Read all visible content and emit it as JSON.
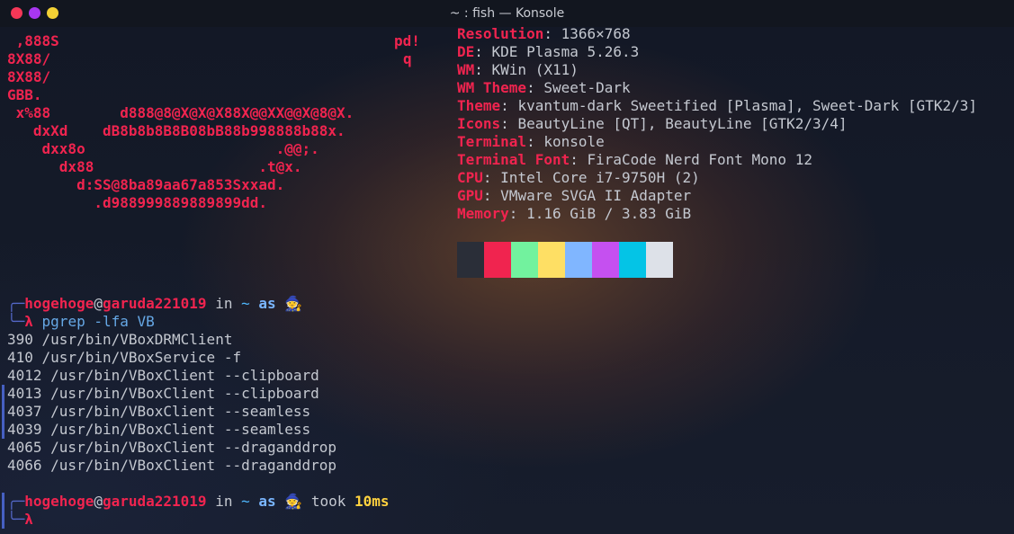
{
  "window": {
    "title": "~ : fish — Konsole",
    "buttons": [
      "close",
      "maximize",
      "minimize"
    ]
  },
  "ascii_art": [
    {
      "text": " ,888S",
      "right": "pd!",
      "rx": 438
    },
    {
      "text": "8X88/",
      "right": "q",
      "rx": 448
    },
    {
      "text": "8X88/"
    },
    {
      "text": "GBB."
    },
    {
      "text": " x%88        d888@8@X@X@X88X@@XX@@X@8@X."
    },
    {
      "text": "   dxXd    dB8b8b8B8B08bB88b998888b88x."
    },
    {
      "text": "    dxx8o                      .@@;."
    },
    {
      "text": "      dx88                   .t@x."
    },
    {
      "text": "        d:SS@8ba89aa67a853Sxxad."
    },
    {
      "text": "          .d988999889889899dd."
    }
  ],
  "sysinfo": [
    {
      "key": "Resolution",
      "value": "1366×768"
    },
    {
      "key": "DE",
      "value": "KDE Plasma 5.26.3"
    },
    {
      "key": "WM",
      "value": "KWin (X11)"
    },
    {
      "key": "WM Theme",
      "value": "Sweet-Dark"
    },
    {
      "key": "Theme",
      "value": "kvantum-dark Sweetified [Plasma], Sweet-Dark [GTK2/3]"
    },
    {
      "key": "Icons",
      "value": "BeautyLine [QT], BeautyLine [GTK2/3/4]"
    },
    {
      "key": "Terminal",
      "value": "konsole"
    },
    {
      "key": "Terminal Font",
      "value": "FiraCode Nerd Font Mono 12"
    },
    {
      "key": "CPU",
      "value": "Intel Core i7-9750H (2)"
    },
    {
      "key": "GPU",
      "value": "VMware SVGA II Adapter"
    },
    {
      "key": "Memory",
      "value": "1.16 GiB / 3.83 GiB"
    }
  ],
  "palette": [
    "#2a2e38",
    "#f0244f",
    "#72f29e",
    "#fedf64",
    "#80b6ff",
    "#c550f0",
    "#04c4e6",
    "#dde1e8"
  ],
  "prompt1": {
    "user": "hogehoge",
    "at": "@",
    "host": "garuda221019",
    "in": " in ",
    "dir": "~",
    "as": " as ",
    "wizard": "🧙",
    "lambda": "λ",
    "command": " pgrep -lfa VB"
  },
  "output": [
    "390 /usr/bin/VBoxDRMClient",
    "410 /usr/bin/VBoxService -f",
    "4012 /usr/bin/VBoxClient --clipboard",
    "4013 /usr/bin/VBoxClient --clipboard",
    "4037 /usr/bin/VBoxClient --seamless",
    "4039 /usr/bin/VBoxClient --seamless",
    "4065 /usr/bin/VBoxClient --draganddrop",
    "4066 /usr/bin/VBoxClient --draganddrop"
  ],
  "prompt2": {
    "user": "hogehoge",
    "at": "@",
    "host": "garuda221019",
    "in": " in ",
    "dir": "~",
    "as": " as ",
    "wizard": "🧙",
    "took": " took ",
    "took_value": "10ms",
    "lambda": "λ"
  },
  "corner_top": "╭─",
  "corner_bottom": "╰─"
}
